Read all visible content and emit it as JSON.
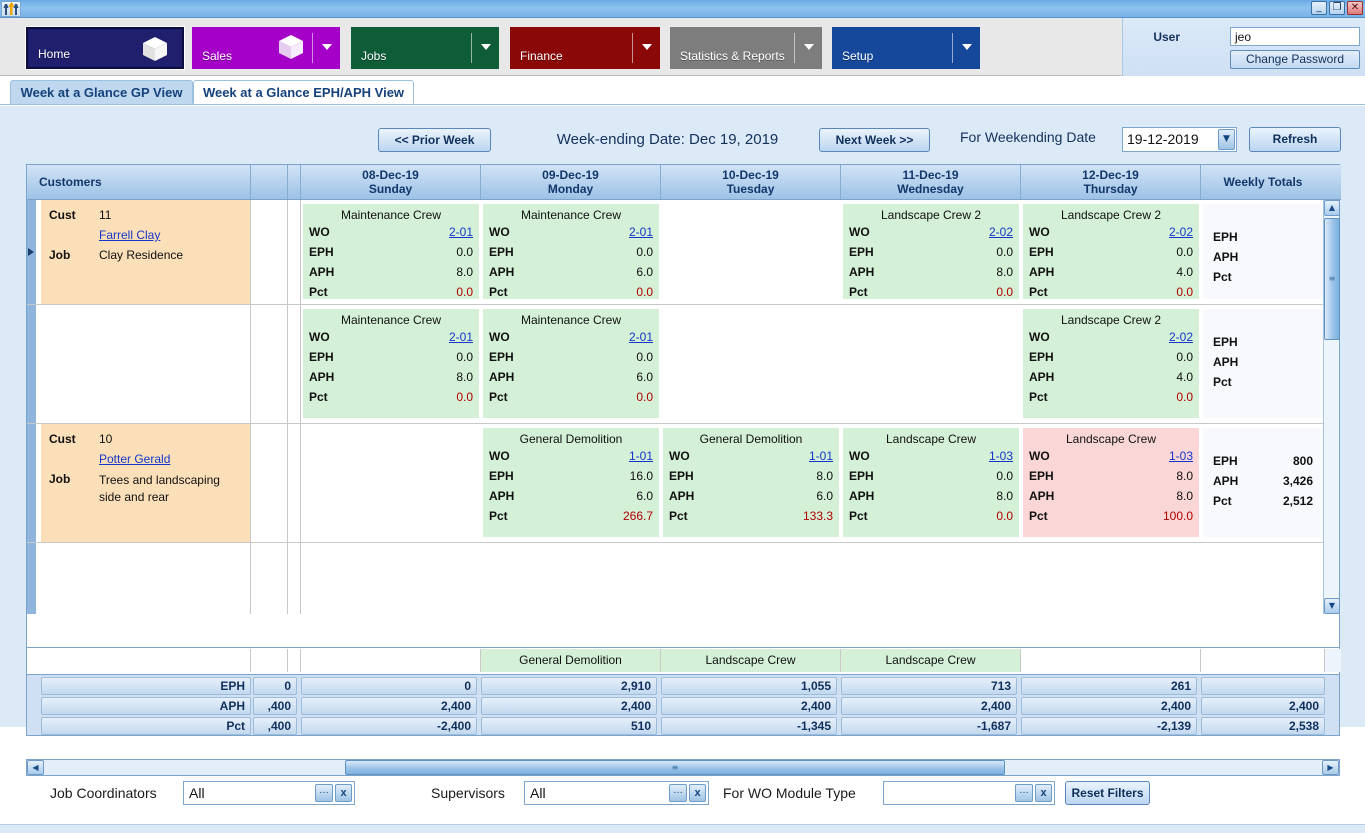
{
  "window": {
    "logo_icon": "people-logo-icon",
    "buttons": [
      {
        "name": "minimize-button",
        "glyph": "_"
      },
      {
        "name": "restore-button",
        "glyph": "❐"
      },
      {
        "name": "close-button",
        "glyph": "✕"
      }
    ]
  },
  "ribbon": {
    "modules": [
      {
        "id": "home",
        "label": "Home",
        "color": "#1f1f6e",
        "caret": false
      },
      {
        "id": "sales",
        "label": "Sales",
        "color": "#a400c8",
        "caret": true
      },
      {
        "id": "jobs",
        "label": "Jobs",
        "color": "#0e5c38",
        "caret": true
      },
      {
        "id": "finance",
        "label": "Finance",
        "color": "#8a0808",
        "caret": true
      },
      {
        "id": "stats",
        "label": "Statistics & Reports",
        "color": "#7d7d7d",
        "caret": true
      },
      {
        "id": "setup",
        "label": "Setup",
        "color": "#15489b",
        "caret": true
      }
    ]
  },
  "user": {
    "label": "User",
    "value": "jeo",
    "change_password_label": "Change Password"
  },
  "tabs": [
    {
      "id": "gp",
      "label": "Week at a Glance GP View",
      "active": false
    },
    {
      "id": "eph",
      "label": "Week at a Glance EPH/APH View",
      "active": true
    }
  ],
  "toolbar": {
    "prior_week_label": "<< Prior Week",
    "week_title": "Week-ending Date: Dec 19, 2019",
    "next_week_label": "Next Week >>",
    "weekending_label": "For Weekending Date",
    "weekending_value": "19-12-2019",
    "refresh_label": "Refresh"
  },
  "grid": {
    "headers": {
      "customers": "Customers",
      "weekly_totals": "Weekly Totals",
      "days": [
        {
          "date": "08-Dec-19",
          "day": "Sunday"
        },
        {
          "date": "09-Dec-19",
          "day": "Monday"
        },
        {
          "date": "10-Dec-19",
          "day": "Tuesday"
        },
        {
          "date": "11-Dec-19",
          "day": "Wednesday"
        },
        {
          "date": "12-Dec-19",
          "day": "Thursday"
        }
      ]
    },
    "labels": {
      "cust": "Cust",
      "job": "Job",
      "wo": "WO",
      "eph": "EPH",
      "aph": "APH",
      "pct": "Pct"
    },
    "rows": [
      {
        "selected": true,
        "cust_number": "11",
        "cust_name": "Farrell Clay",
        "job_name": "Clay Residence",
        "days": [
          {
            "crew": "Maintenance Crew",
            "wo": "2-01",
            "eph": "0.0",
            "aph": "8.0",
            "pct": "0.0",
            "fill": "green"
          },
          {
            "crew": "Maintenance Crew",
            "wo": "2-01",
            "eph": "0.0",
            "aph": "6.0",
            "pct": "0.0",
            "fill": "green"
          },
          null,
          {
            "crew": "Landscape Crew 2",
            "wo": "2-02",
            "eph": "0.0",
            "aph": "8.0",
            "pct": "0.0",
            "fill": "green"
          },
          {
            "crew": "Landscape Crew 2",
            "wo": "2-02",
            "eph": "0.0",
            "aph": "4.0",
            "pct": "0.0",
            "fill": "green"
          }
        ],
        "totals": {
          "eph": "",
          "aph": "",
          "pct": ""
        }
      },
      {
        "selected": false,
        "cust_number": "",
        "cust_name": "",
        "job_name": "",
        "blank_cust": true,
        "days": [
          {
            "crew": "Maintenance Crew",
            "wo": "2-01",
            "eph": "0.0",
            "aph": "8.0",
            "pct": "0.0",
            "fill": "green"
          },
          {
            "crew": "Maintenance Crew",
            "wo": "2-01",
            "eph": "0.0",
            "aph": "6.0",
            "pct": "0.0",
            "fill": "green"
          },
          null,
          null,
          {
            "crew": "Landscape Crew 2",
            "wo": "2-02",
            "eph": "0.0",
            "aph": "4.0",
            "pct": "0.0",
            "fill": "green"
          }
        ],
        "totals": {
          "eph": "",
          "aph": "",
          "pct": ""
        }
      },
      {
        "selected": false,
        "cust_number": "10",
        "cust_name": "Potter Gerald",
        "job_name": "Trees and landscaping side and rear",
        "days": [
          null,
          {
            "crew": "General Demolition",
            "wo": "1-01",
            "eph": "16.0",
            "aph": "6.0",
            "pct": "266.7",
            "fill": "green"
          },
          {
            "crew": "General Demolition",
            "wo": "1-01",
            "eph": "8.0",
            "aph": "6.0",
            "pct": "133.3",
            "fill": "green"
          },
          {
            "crew": "Landscape Crew",
            "wo": "1-03",
            "eph": "0.0",
            "aph": "8.0",
            "pct": "0.0",
            "fill": "green"
          },
          {
            "crew": "Landscape Crew",
            "wo": "1-03",
            "eph": "8.0",
            "aph": "8.0",
            "pct": "100.0",
            "fill": "pink"
          }
        ],
        "totals": {
          "eph": "800",
          "aph": "3,426",
          "pct": "2,512"
        }
      }
    ]
  },
  "footer": {
    "crews": [
      "",
      "",
      "General Demolition",
      "Landscape Crew",
      "Landscape Crew",
      "",
      ""
    ],
    "row_labels": [
      "EPH",
      "APH",
      "Pct"
    ],
    "clipped_column": {
      "eph": "0",
      "aph": ",400",
      "pct": ",400"
    },
    "values": {
      "eph": [
        "0",
        "2,910",
        "1,055",
        "713",
        "261",
        ""
      ],
      "aph": [
        "2,400",
        "2,400",
        "2,400",
        "2,400",
        "2,400",
        "2,400"
      ],
      "pct": [
        "-2,400",
        "510",
        "-1,345",
        "-1,687",
        "-2,139",
        "2,538"
      ]
    }
  },
  "filters": {
    "job_coordinators_label": "Job Coordinators",
    "job_coordinators_value": "All",
    "supervisors_label": "Supervisors",
    "supervisors_value": "All",
    "wo_module_label": "For WO Module Type",
    "wo_module_value": "",
    "reset_label": "Reset Filters",
    "ellipsis_glyph": "…",
    "clear_glyph": "x"
  },
  "scrollbars": {
    "up_glyph": "▲",
    "down_glyph": "▼",
    "left_glyph": "◀",
    "right_glyph": "▶",
    "grip_glyph": "≡"
  }
}
